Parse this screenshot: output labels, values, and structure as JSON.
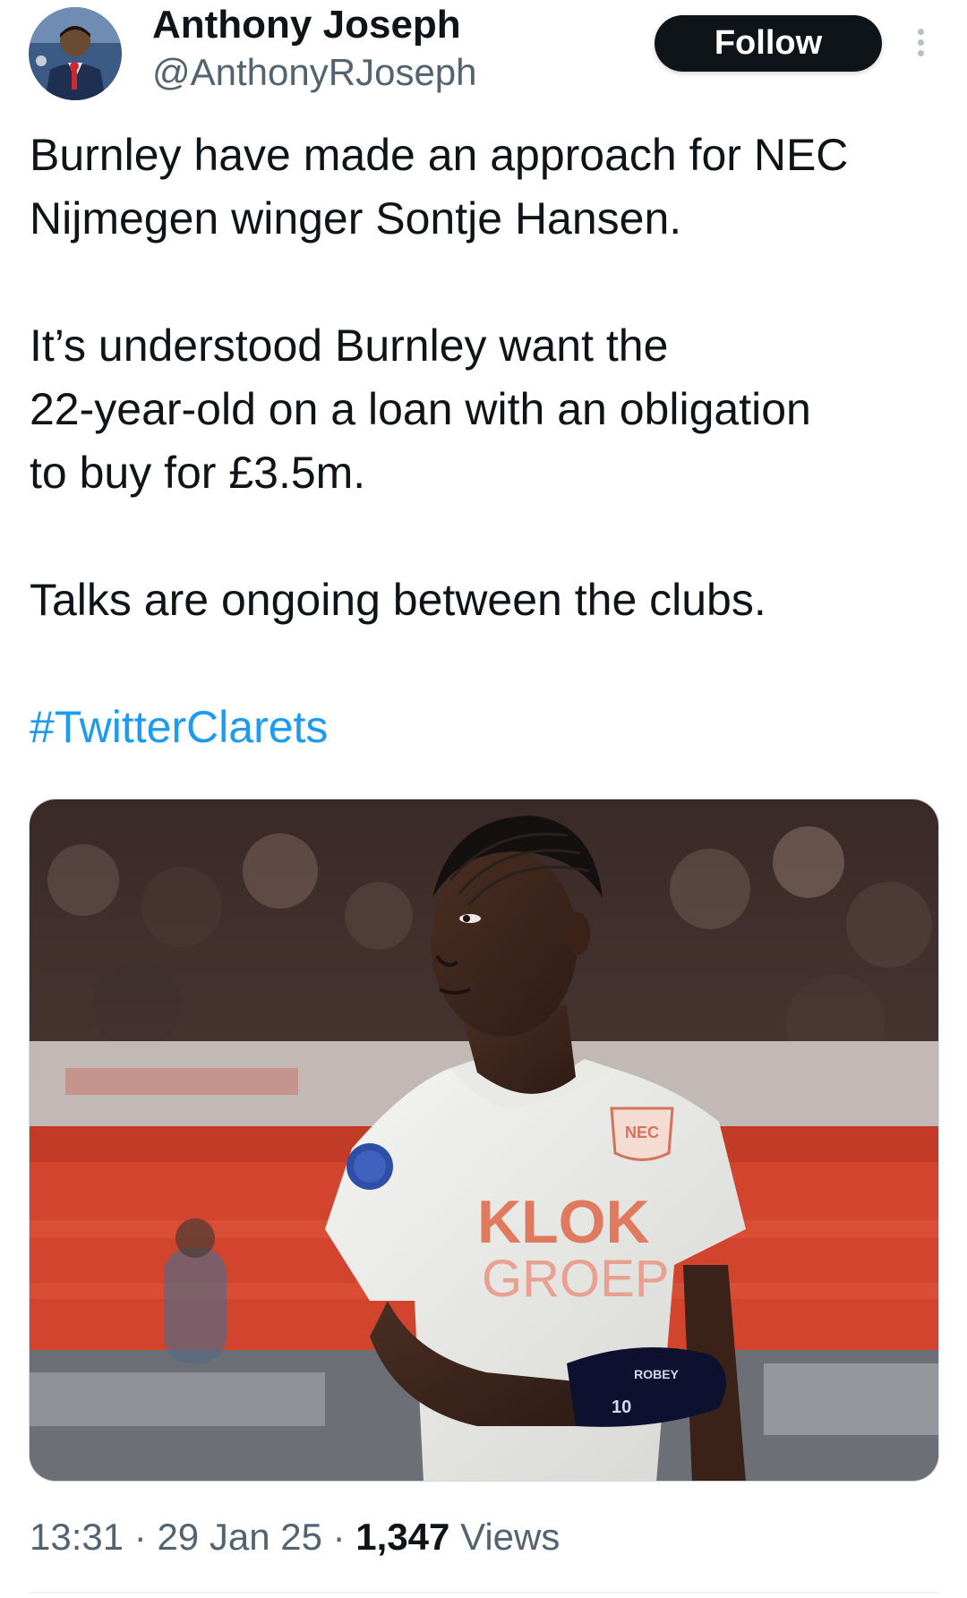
{
  "author": {
    "display_name": "Anthony Joseph",
    "handle": "@AnthonyRJoseph",
    "avatar_icon": "avatar-reporter-photo"
  },
  "actions": {
    "follow_label": "Follow",
    "more_icon": "vertical-ellipsis-icon"
  },
  "tweet": {
    "paragraphs": [
      [
        "Burnley have made an approach for NEC",
        "Nijmegen winger Sontje Hansen."
      ],
      [
        "It’s understood Burnley want the",
        "22-year-old on a loan with an obligation",
        "to buy for £3.5m."
      ],
      [
        "Talks are ongoing between the clubs."
      ]
    ],
    "hashtag": "#TwitterClarets"
  },
  "media": {
    "description_icon": "photo-footballer",
    "shirt_text_line1": "KLOK",
    "shirt_text_line2": "GROEP",
    "crest_text": "NEC",
    "glove_text": "ROBEY",
    "glove_number": "10"
  },
  "meta": {
    "time": "13:31",
    "separator": "·",
    "date": "29 Jan 25",
    "views_count": "1,347",
    "views_label": "Views"
  },
  "colors": {
    "text": "#0f1419",
    "secondary": "#536471",
    "link": "#1d9bf0",
    "button_bg": "#0f1419",
    "button_text": "#ffffff"
  }
}
